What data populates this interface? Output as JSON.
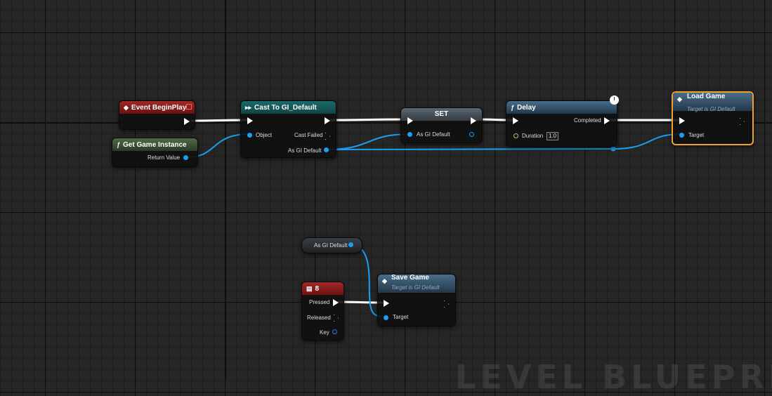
{
  "nodes": {
    "event_begin_play": {
      "title": "Event BeginPlay"
    },
    "get_game_instance": {
      "title": "Get Game Instance",
      "out_label": "Return Value"
    },
    "cast": {
      "title": "Cast To GI_Default",
      "in_object": "Object",
      "cast_failed": "Cast Failed",
      "out_label": "As GI Default"
    },
    "set": {
      "title": "SET",
      "in_label": "As GI Default"
    },
    "delay": {
      "title": "Delay",
      "completed": "Completed",
      "duration_label": "Duration",
      "duration_value": "1.0"
    },
    "load_game": {
      "title": "Load Game",
      "subtitle": "Target is GI Default",
      "target": "Target"
    },
    "var_get": {
      "label": "As GI Default"
    },
    "key_event": {
      "title": "8",
      "pressed": "Pressed",
      "released": "Released",
      "key": "Key"
    },
    "save_game": {
      "title": "Save Game",
      "subtitle": "Target is GI Default",
      "target": "Target"
    }
  },
  "watermark": "LEVEL BLUEPRINT",
  "colors": {
    "object_pin": "#1a9ff0",
    "exec": "#ffffff",
    "event_header": "#a12828",
    "selected": "#f0a030"
  }
}
